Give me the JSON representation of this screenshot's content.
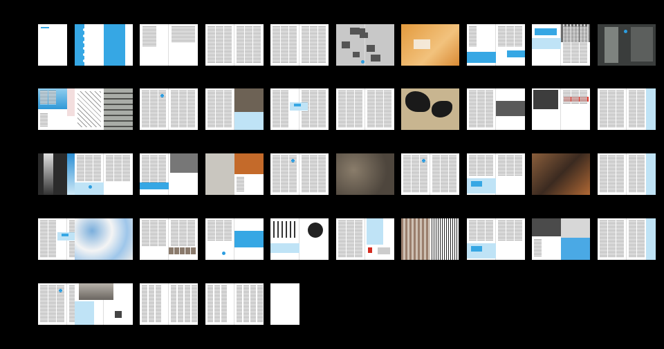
{
  "palette": {
    "background": "#000000",
    "page": "#ffffff",
    "accent_blue": "#36a7e4",
    "light_blue": "#bfe3f6",
    "dot_blue": "#2c9de0"
  },
  "spreads": [
    {
      "id": 1,
      "kind": "cover-right"
    },
    {
      "id": 2,
      "kind": "blue-bands"
    },
    {
      "id": 3,
      "kind": "contents"
    },
    {
      "id": 4,
      "kind": "text"
    },
    {
      "id": 5,
      "kind": "text"
    },
    {
      "id": 6,
      "kind": "collage-grey"
    },
    {
      "id": 7,
      "kind": "orange-photo"
    },
    {
      "id": 8,
      "kind": "text-blue-image"
    },
    {
      "id": 9,
      "kind": "text-building-photo"
    },
    {
      "id": 10,
      "kind": "dark-photos"
    },
    {
      "id": 11,
      "kind": "blue-pink-art"
    },
    {
      "id": 12,
      "kind": "drawing-building"
    },
    {
      "id": 13,
      "kind": "text-dot"
    },
    {
      "id": 14,
      "kind": "text-room-photo"
    },
    {
      "id": 15,
      "kind": "text-blue-box"
    },
    {
      "id": 16,
      "kind": "text"
    },
    {
      "id": 17,
      "kind": "ink-photo"
    },
    {
      "id": 18,
      "kind": "text-group-photo"
    },
    {
      "id": 19,
      "kind": "red-banner"
    },
    {
      "id": 20,
      "kind": "text-blue-sidebar"
    },
    {
      "id": 21,
      "kind": "light-sky-photo"
    },
    {
      "id": 22,
      "kind": "text-blue-panel"
    },
    {
      "id": 23,
      "kind": "text-bw-photo"
    },
    {
      "id": 24,
      "kind": "interior-orange"
    },
    {
      "id": 25,
      "kind": "text-dot"
    },
    {
      "id": 26,
      "kind": "textured-full"
    },
    {
      "id": 27,
      "kind": "text-dot"
    },
    {
      "id": 28,
      "kind": "text-blue-photo"
    },
    {
      "id": 29,
      "kind": "workshop-photo"
    },
    {
      "id": 30,
      "kind": "text-blue-sidebar"
    },
    {
      "id": 31,
      "kind": "text-blue-box"
    },
    {
      "id": 32,
      "kind": "blue-speckle"
    },
    {
      "id": 33,
      "kind": "text-portraits"
    },
    {
      "id": 34,
      "kind": "text-blue-model"
    },
    {
      "id": 35,
      "kind": "circle-diagram"
    },
    {
      "id": 36,
      "kind": "text-small-items"
    },
    {
      "id": 37,
      "kind": "building-stripes"
    },
    {
      "id": 38,
      "kind": "text-blue-photo"
    },
    {
      "id": 39,
      "kind": "photo-blue-building"
    },
    {
      "id": 40,
      "kind": "text-blue-sidebar"
    },
    {
      "id": 41,
      "kind": "text-dot"
    },
    {
      "id": 42,
      "kind": "towers-photo"
    },
    {
      "id": 43,
      "kind": "index"
    },
    {
      "id": 44,
      "kind": "index"
    },
    {
      "id": 45,
      "kind": "back-cover"
    }
  ]
}
